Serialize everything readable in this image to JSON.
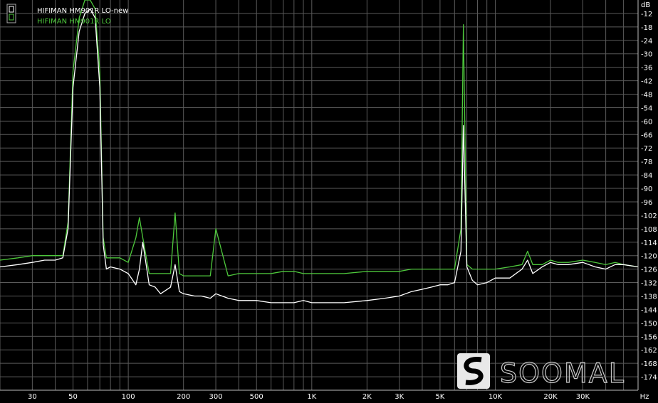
{
  "chart_data": {
    "type": "line",
    "title": "",
    "xlabel": "",
    "ylabel": "",
    "x_scale": "log",
    "xlim": [
      20,
      60000
    ],
    "ylim": [
      -180,
      -6
    ],
    "x_unit": "Hz",
    "y_unit": "dB",
    "x_ticks": [
      {
        "v": 30,
        "l": "30"
      },
      {
        "v": 50,
        "l": "50"
      },
      {
        "v": 100,
        "l": "100"
      },
      {
        "v": 200,
        "l": "200"
      },
      {
        "v": 300,
        "l": "300"
      },
      {
        "v": 500,
        "l": "500"
      },
      {
        "v": 1000,
        "l": "1K"
      },
      {
        "v": 2000,
        "l": "2K"
      },
      {
        "v": 3000,
        "l": "3K"
      },
      {
        "v": 5000,
        "l": "5K"
      },
      {
        "v": 10000,
        "l": "10K"
      },
      {
        "v": 20000,
        "l": "20K"
      },
      {
        "v": 30000,
        "l": "30K"
      }
    ],
    "y_ticks": [
      -12,
      -18,
      -24,
      -30,
      -36,
      -42,
      -48,
      -54,
      -60,
      -66,
      -72,
      -78,
      -84,
      -90,
      -96,
      -102,
      -108,
      -114,
      -120,
      -126,
      -132,
      -138,
      -144,
      -150,
      -156,
      -162,
      -168,
      -174
    ],
    "grid": true,
    "legend_position": "top-left",
    "series": [
      {
        "name": "HIFIMAN HM901R LO-new",
        "color": "#ffffff",
        "x": [
          20,
          25,
          30,
          35,
          40,
          44,
          47,
          50,
          54,
          58,
          62,
          66,
          70,
          73,
          76,
          80,
          90,
          100,
          110,
          115,
          120,
          130,
          140,
          150,
          170,
          180,
          190,
          200,
          230,
          250,
          280,
          300,
          350,
          400,
          500,
          600,
          700,
          800,
          900,
          1000,
          1500,
          2000,
          2500,
          3000,
          3500,
          4000,
          4500,
          5000,
          5500,
          6000,
          6500,
          6700,
          7000,
          7500,
          8000,
          9000,
          10000,
          12000,
          14000,
          15000,
          16000,
          18000,
          20000,
          22000,
          25000,
          30000,
          35000,
          40000,
          45000,
          50000,
          60000
        ],
        "y": [
          -125,
          -124,
          -123,
          -122,
          -122,
          -121,
          -108,
          -45,
          -20,
          -12,
          -10,
          -14,
          -45,
          -115,
          -126,
          -125,
          -126,
          -128,
          -133,
          -126,
          -114,
          -133,
          -134,
          -137,
          -134,
          -124,
          -136,
          -137,
          -138,
          -138,
          -139,
          -137,
          -139,
          -140,
          -140,
          -141,
          -141,
          -141,
          -140,
          -141,
          -141,
          -140,
          -139,
          -138,
          -136,
          -135,
          -134,
          -133,
          -133,
          -132,
          -118,
          -62,
          -125,
          -131,
          -133,
          -132,
          -130,
          -130,
          -126,
          -122,
          -128,
          -125,
          -123,
          -124,
          -124,
          -123,
          -125,
          -126,
          -124,
          -124,
          -125
        ]
      },
      {
        "name": "HIFIMAN HM901R LO",
        "color": "#4ec83c",
        "x": [
          20,
          25,
          30,
          35,
          40,
          44,
          47,
          50,
          54,
          58,
          62,
          66,
          70,
          73,
          76,
          80,
          90,
          100,
          110,
          115,
          120,
          130,
          140,
          150,
          170,
          180,
          190,
          200,
          230,
          250,
          280,
          300,
          350,
          400,
          500,
          600,
          700,
          800,
          900,
          1000,
          1500,
          2000,
          2500,
          3000,
          3500,
          4000,
          4500,
          5000,
          5500,
          6000,
          6500,
          6700,
          7000,
          7500,
          8000,
          9000,
          10000,
          12000,
          14000,
          15000,
          16000,
          18000,
          20000,
          22000,
          25000,
          30000,
          35000,
          40000,
          45000,
          50000,
          60000
        ],
        "y": [
          -122,
          -121,
          -120,
          -120,
          -120,
          -120,
          -105,
          -38,
          -14,
          -6,
          -6,
          -10,
          -38,
          -112,
          -121,
          -121,
          -121,
          -123,
          -112,
          -103,
          -112,
          -128,
          -128,
          -128,
          -128,
          -101,
          -128,
          -129,
          -129,
          -129,
          -129,
          -108,
          -129,
          -128,
          -128,
          -128,
          -127,
          -127,
          -128,
          -128,
          -128,
          -127,
          -127,
          -127,
          -126,
          -126,
          -126,
          -126,
          -126,
          -126,
          -108,
          -17,
          -124,
          -126,
          -126,
          -126,
          -126,
          -125,
          -124,
          -118,
          -124,
          -124,
          -122,
          -123,
          -123,
          -122,
          -123,
          -124,
          -123,
          -124,
          -125
        ]
      }
    ]
  },
  "watermark": {
    "text": "SOOMAL",
    "badge_color": "#e8e8e8"
  }
}
